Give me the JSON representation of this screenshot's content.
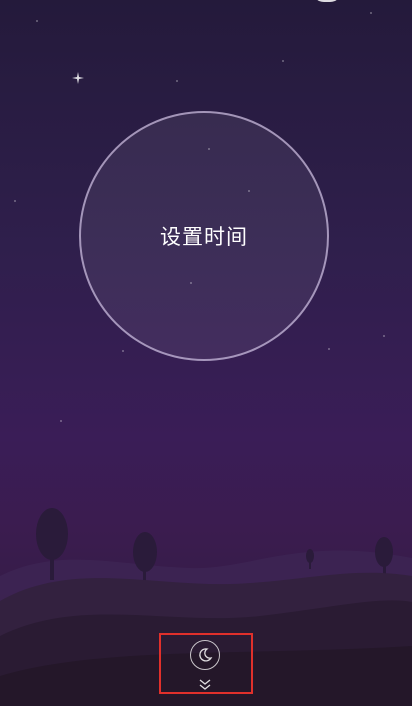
{
  "timer": {
    "label": "设置时间"
  },
  "icons": {
    "sleep": "crescent-moon-icon",
    "expand": "double-chevron-down-icon",
    "sparkle": "sparkle-star-icon"
  },
  "colors": {
    "highlight_border": "#e0302b",
    "circle_border": "#c8b9dc"
  }
}
